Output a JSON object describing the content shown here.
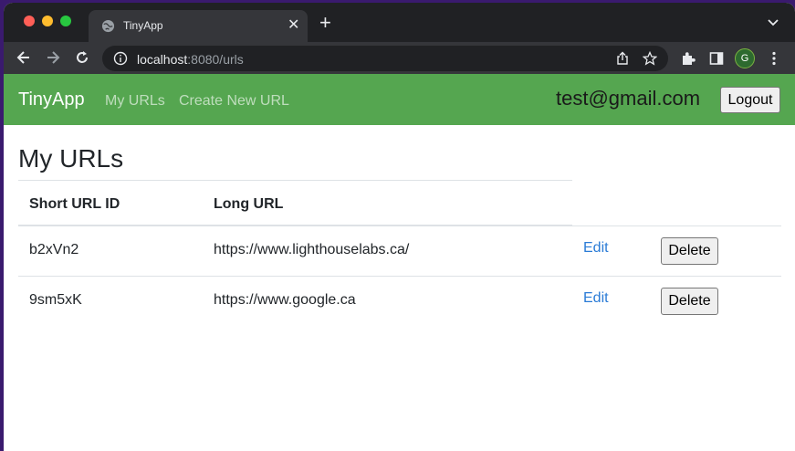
{
  "browser": {
    "tab_title": "TinyApp",
    "tab_close": "✕",
    "new_tab": "+",
    "url_host": "localhost",
    "url_rest": ":8080/urls",
    "profile_initial": "G",
    "icons": [
      "globe-icon",
      "back-icon",
      "forward-icon",
      "reload-icon",
      "info-icon",
      "share-icon",
      "star-icon",
      "puzzle-icon",
      "sidepanel-icon",
      "kebab-icon",
      "tab-menu-icon"
    ]
  },
  "navbar": {
    "brand": "TinyApp",
    "links": [
      "My URLs",
      "Create New URL"
    ],
    "user_email": "test@gmail.com",
    "logout_label": "Logout",
    "color": "#55a650"
  },
  "main": {
    "title": "My URLs",
    "columns": [
      "Short URL ID",
      "Long URL"
    ],
    "rows": [
      {
        "id": "b2xVn2",
        "url": "https://www.lighthouselabs.ca/",
        "edit": "Edit",
        "delete": "Delete"
      },
      {
        "id": "9sm5xK",
        "url": "https://www.google.ca",
        "edit": "Edit",
        "delete": "Delete"
      }
    ],
    "link_color": "#2a7bd6"
  }
}
